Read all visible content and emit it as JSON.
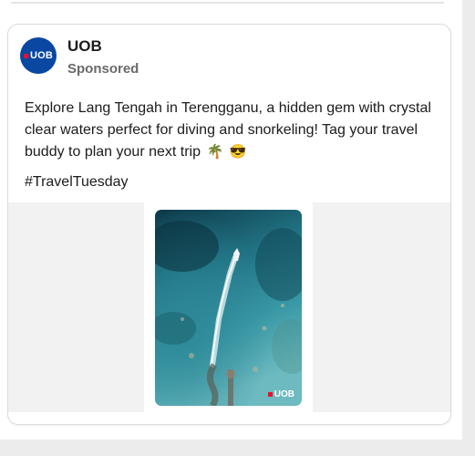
{
  "post": {
    "page_name": "UOB",
    "sponsored_label": "Sponsored",
    "avatar_text": "UOB",
    "text_line1": "Explore Lang Tengah in Terengganu, a hidden gem with crystal",
    "text_line2": "clear waters perfect for diving and snorkeling! Tag your travel",
    "text_line3": "buddy to plan your next trip",
    "emoji_1": "🌴",
    "emoji_2": "😎",
    "hashtag": "#TravelTuesday",
    "image_watermark": "UOB"
  },
  "colors": {
    "brand_blue": "#0a47a3",
    "brand_red": "#e8112d",
    "sea_dark": "#0f4050",
    "sea_light": "#5fb9c4"
  },
  "icons": {
    "avatar": "uob-logo-icon",
    "watermark": "uob-logo-icon"
  }
}
